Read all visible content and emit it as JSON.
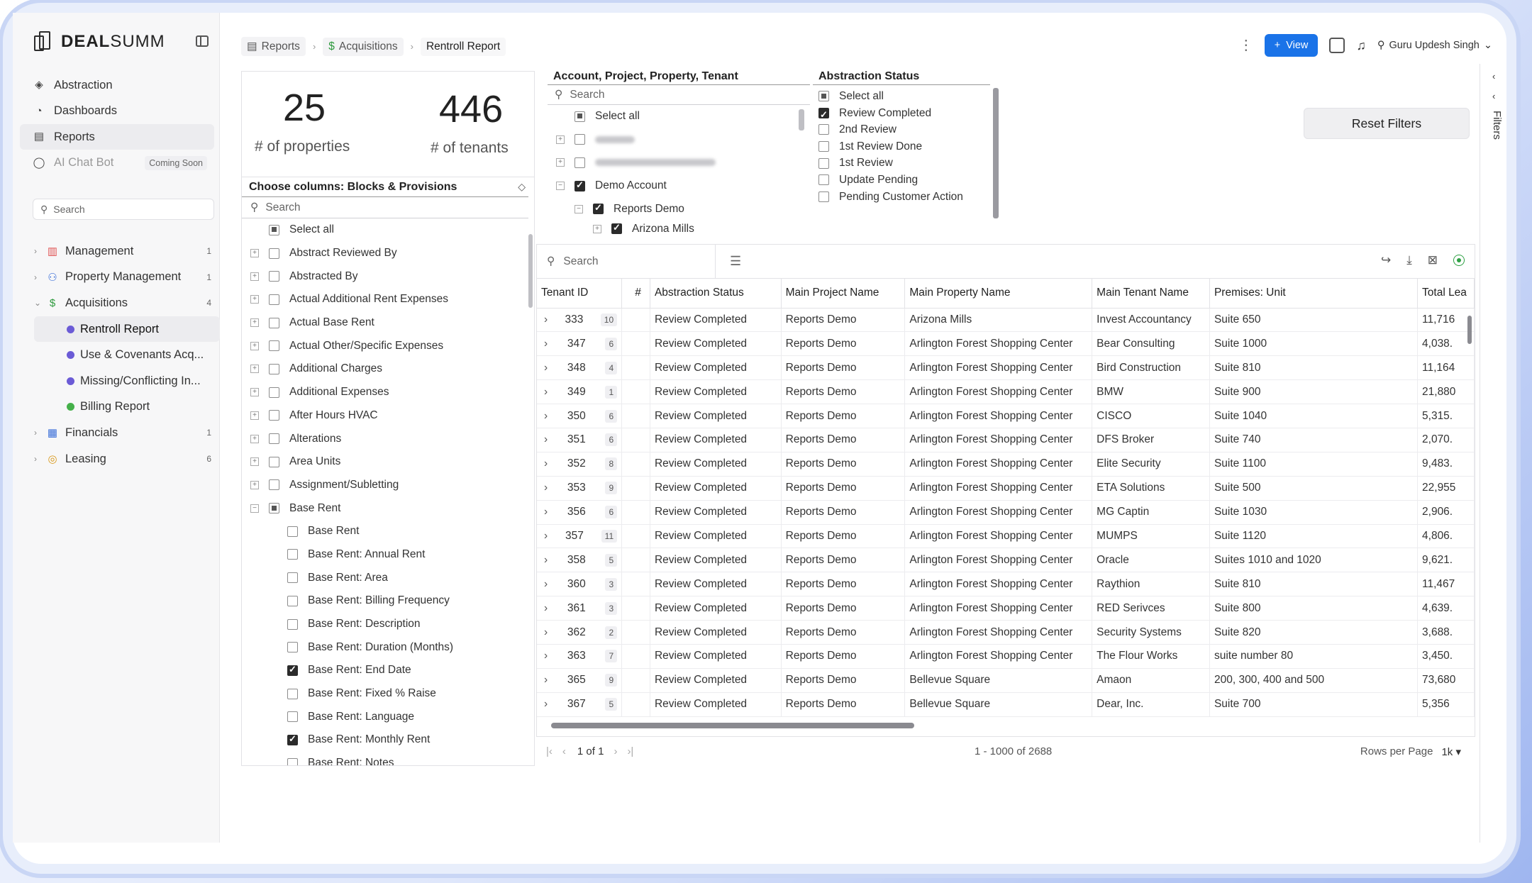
{
  "brand": {
    "name_bold": "DEAL",
    "name_light": "SUMM"
  },
  "sidebar": {
    "nav": [
      {
        "label": "Abstraction",
        "icon": "layers-icon"
      },
      {
        "label": "Dashboards",
        "icon": "pie-chart-icon"
      },
      {
        "label": "Reports",
        "icon": "document-icon"
      },
      {
        "label": "AI Chat Bot",
        "icon": "chat-icon",
        "badge": "Coming Soon"
      }
    ],
    "search_placeholder": "Search",
    "tree": [
      {
        "label": "Management",
        "count": "1",
        "color": "#e05252"
      },
      {
        "label": "Property Management",
        "count": "1",
        "color": "#3b6fd8"
      },
      {
        "label": "Acquisitions",
        "count": "4",
        "color": "#2e9a3e"
      },
      {
        "label": "Rentroll Report",
        "color": "#6b5bd6"
      },
      {
        "label": "Use & Covenants Acq...",
        "color": "#6b5bd6"
      },
      {
        "label": "Missing/Conflicting In...",
        "color": "#6b5bd6"
      },
      {
        "label": "Billing Report",
        "color": "#45b04a"
      },
      {
        "label": "Financials",
        "count": "1",
        "color": "#3b6fd8"
      },
      {
        "label": "Leasing",
        "count": "6",
        "color": "#d99a1e"
      }
    ]
  },
  "topbar": {
    "breadcrumbs": [
      "Reports",
      "Acquisitions",
      "Rentroll Report"
    ],
    "view_label": "View",
    "user_name": "Guru Updesh Singh"
  },
  "summary": {
    "properties_count": "25",
    "properties_label": "# of properties",
    "tenants_count": "446",
    "tenants_label": "# of tenants"
  },
  "columns_panel": {
    "title": "Choose columns: Blocks & Provisions",
    "search_placeholder": "Search",
    "select_all": "Select all",
    "items": [
      "Abstract Reviewed By",
      "Abstracted By",
      "Actual Additional Rent Expenses",
      "Actual Base Rent",
      "Actual Other/Specific Expenses",
      "Additional Charges",
      "Additional Expenses",
      "After Hours HVAC",
      "Alterations",
      "Area Units",
      "Assignment/Subletting",
      "Base Rent"
    ],
    "children": [
      {
        "label": "Base Rent",
        "checked": false
      },
      {
        "label": "Base Rent: Annual Rent",
        "checked": false
      },
      {
        "label": "Base Rent: Area",
        "checked": false
      },
      {
        "label": "Base Rent: Billing Frequency",
        "checked": false
      },
      {
        "label": "Base Rent: Description",
        "checked": false
      },
      {
        "label": "Base Rent: Duration (Months)",
        "checked": false
      },
      {
        "label": "Base Rent: End Date",
        "checked": true
      },
      {
        "label": "Base Rent: Fixed % Raise",
        "checked": false
      },
      {
        "label": "Base Rent: Language",
        "checked": false
      },
      {
        "label": "Base Rent: Monthly Rent",
        "checked": true
      },
      {
        "label": "Base Rent: Notes",
        "checked": false
      }
    ]
  },
  "filter_account": {
    "title": "Account, Project, Property, Tenant",
    "search_placeholder": "Search",
    "select_all": "Select all",
    "demo_account": "Demo Account",
    "reports_demo": "Reports Demo",
    "arizona_mills": "Arizona Mills"
  },
  "filter_status": {
    "title": "Abstraction Status",
    "options": [
      {
        "label": "Select all",
        "state": "partial"
      },
      {
        "label": "Review Completed",
        "state": "checked"
      },
      {
        "label": "2nd Review",
        "state": "unchecked"
      },
      {
        "label": "1st Review Done",
        "state": "unchecked"
      },
      {
        "label": "1st Review",
        "state": "unchecked"
      },
      {
        "label": "Update Pending",
        "state": "unchecked"
      },
      {
        "label": "Pending Customer Action",
        "state": "unchecked"
      }
    ]
  },
  "reset_label": "Reset Filters",
  "filters_tab_label": "Filters",
  "grid": {
    "search_placeholder": "Search",
    "headers": [
      "Tenant ID",
      "#",
      "Abstraction Status",
      "Main Project Name",
      "Main Property Name",
      "Main Tenant Name",
      "Premises: Unit",
      "Total Lea"
    ],
    "rows": [
      [
        "333",
        "10",
        "Review Completed",
        "Reports Demo",
        "Arizona Mills",
        "Invest Accountancy",
        "Suite 650",
        "11,716"
      ],
      [
        "347",
        "6",
        "Review Completed",
        "Reports Demo",
        "Arlington Forest Shopping Center",
        "Bear Consulting",
        "Suite 1000",
        "4,038."
      ],
      [
        "348",
        "4",
        "Review Completed",
        "Reports Demo",
        "Arlington Forest Shopping Center",
        "Bird Construction",
        "Suite 810",
        "11,164"
      ],
      [
        "349",
        "1",
        "Review Completed",
        "Reports Demo",
        "Arlington Forest Shopping Center",
        "BMW",
        "Suite 900",
        "21,880"
      ],
      [
        "350",
        "6",
        "Review Completed",
        "Reports Demo",
        "Arlington Forest Shopping Center",
        "CISCO",
        "Suite 1040",
        "5,315."
      ],
      [
        "351",
        "6",
        "Review Completed",
        "Reports Demo",
        "Arlington Forest Shopping Center",
        "DFS Broker",
        "Suite 740",
        "2,070."
      ],
      [
        "352",
        "8",
        "Review Completed",
        "Reports Demo",
        "Arlington Forest Shopping Center",
        "Elite Security",
        "Suite 1100",
        "9,483."
      ],
      [
        "353",
        "9",
        "Review Completed",
        "Reports Demo",
        "Arlington Forest Shopping Center",
        "ETA Solutions",
        "Suite 500",
        "22,955"
      ],
      [
        "356",
        "6",
        "Review Completed",
        "Reports Demo",
        "Arlington Forest Shopping Center",
        "MG Captin",
        "Suite 1030",
        "2,906."
      ],
      [
        "357",
        "11",
        "Review Completed",
        "Reports Demo",
        "Arlington Forest Shopping Center",
        "MUMPS",
        "Suite 1120",
        "4,806."
      ],
      [
        "358",
        "5",
        "Review Completed",
        "Reports Demo",
        "Arlington Forest Shopping Center",
        "Oracle",
        "Suites 1010 and 1020",
        "9,621."
      ],
      [
        "360",
        "3",
        "Review Completed",
        "Reports Demo",
        "Arlington Forest Shopping Center",
        "Raythion",
        "Suite 810",
        "11,467"
      ],
      [
        "361",
        "3",
        "Review Completed",
        "Reports Demo",
        "Arlington Forest Shopping Center",
        "RED Serivces",
        "Suite 800",
        "4,639."
      ],
      [
        "362",
        "2",
        "Review Completed",
        "Reports Demo",
        "Arlington Forest Shopping Center",
        "Security Systems",
        "Suite 820",
        "3,688."
      ],
      [
        "363",
        "7",
        "Review Completed",
        "Reports Demo",
        "Arlington Forest Shopping Center",
        "The Flour Works",
        "suite number 80",
        "3,450."
      ],
      [
        "365",
        "9",
        "Review Completed",
        "Reports Demo",
        "Bellevue Square",
        "Amaon",
        "200, 300, 400 and 500",
        "73,680"
      ],
      [
        "367",
        "5",
        "Review Completed",
        "Reports Demo",
        "Bellevue Square",
        "Dear, Inc.",
        "Suite 700",
        "5,356"
      ]
    ]
  },
  "pager": {
    "page_text": "1 of 1",
    "range_text": "1 - 1000 of 2688",
    "rows_per_page_label": "Rows per Page",
    "rows_per_page_value": "1k"
  }
}
